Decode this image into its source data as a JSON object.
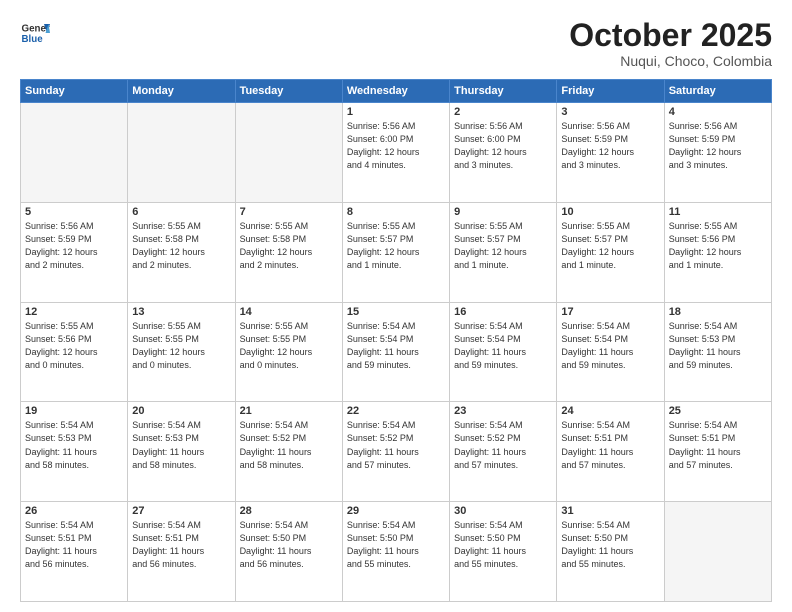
{
  "header": {
    "logo_line1": "General",
    "logo_line2": "Blue",
    "title": "October 2025",
    "subtitle": "Nuqui, Choco, Colombia"
  },
  "weekdays": [
    "Sunday",
    "Monday",
    "Tuesday",
    "Wednesday",
    "Thursday",
    "Friday",
    "Saturday"
  ],
  "weeks": [
    [
      {
        "day": "",
        "info": "",
        "empty": true
      },
      {
        "day": "",
        "info": "",
        "empty": true
      },
      {
        "day": "",
        "info": "",
        "empty": true
      },
      {
        "day": "1",
        "info": "Sunrise: 5:56 AM\nSunset: 6:00 PM\nDaylight: 12 hours\nand 4 minutes.",
        "empty": false
      },
      {
        "day": "2",
        "info": "Sunrise: 5:56 AM\nSunset: 6:00 PM\nDaylight: 12 hours\nand 3 minutes.",
        "empty": false
      },
      {
        "day": "3",
        "info": "Sunrise: 5:56 AM\nSunset: 5:59 PM\nDaylight: 12 hours\nand 3 minutes.",
        "empty": false
      },
      {
        "day": "4",
        "info": "Sunrise: 5:56 AM\nSunset: 5:59 PM\nDaylight: 12 hours\nand 3 minutes.",
        "empty": false
      }
    ],
    [
      {
        "day": "5",
        "info": "Sunrise: 5:56 AM\nSunset: 5:59 PM\nDaylight: 12 hours\nand 2 minutes.",
        "empty": false
      },
      {
        "day": "6",
        "info": "Sunrise: 5:55 AM\nSunset: 5:58 PM\nDaylight: 12 hours\nand 2 minutes.",
        "empty": false
      },
      {
        "day": "7",
        "info": "Sunrise: 5:55 AM\nSunset: 5:58 PM\nDaylight: 12 hours\nand 2 minutes.",
        "empty": false
      },
      {
        "day": "8",
        "info": "Sunrise: 5:55 AM\nSunset: 5:57 PM\nDaylight: 12 hours\nand 1 minute.",
        "empty": false
      },
      {
        "day": "9",
        "info": "Sunrise: 5:55 AM\nSunset: 5:57 PM\nDaylight: 12 hours\nand 1 minute.",
        "empty": false
      },
      {
        "day": "10",
        "info": "Sunrise: 5:55 AM\nSunset: 5:57 PM\nDaylight: 12 hours\nand 1 minute.",
        "empty": false
      },
      {
        "day": "11",
        "info": "Sunrise: 5:55 AM\nSunset: 5:56 PM\nDaylight: 12 hours\nand 1 minute.",
        "empty": false
      }
    ],
    [
      {
        "day": "12",
        "info": "Sunrise: 5:55 AM\nSunset: 5:56 PM\nDaylight: 12 hours\nand 0 minutes.",
        "empty": false
      },
      {
        "day": "13",
        "info": "Sunrise: 5:55 AM\nSunset: 5:55 PM\nDaylight: 12 hours\nand 0 minutes.",
        "empty": false
      },
      {
        "day": "14",
        "info": "Sunrise: 5:55 AM\nSunset: 5:55 PM\nDaylight: 12 hours\nand 0 minutes.",
        "empty": false
      },
      {
        "day": "15",
        "info": "Sunrise: 5:54 AM\nSunset: 5:54 PM\nDaylight: 11 hours\nand 59 minutes.",
        "empty": false
      },
      {
        "day": "16",
        "info": "Sunrise: 5:54 AM\nSunset: 5:54 PM\nDaylight: 11 hours\nand 59 minutes.",
        "empty": false
      },
      {
        "day": "17",
        "info": "Sunrise: 5:54 AM\nSunset: 5:54 PM\nDaylight: 11 hours\nand 59 minutes.",
        "empty": false
      },
      {
        "day": "18",
        "info": "Sunrise: 5:54 AM\nSunset: 5:53 PM\nDaylight: 11 hours\nand 59 minutes.",
        "empty": false
      }
    ],
    [
      {
        "day": "19",
        "info": "Sunrise: 5:54 AM\nSunset: 5:53 PM\nDaylight: 11 hours\nand 58 minutes.",
        "empty": false
      },
      {
        "day": "20",
        "info": "Sunrise: 5:54 AM\nSunset: 5:53 PM\nDaylight: 11 hours\nand 58 minutes.",
        "empty": false
      },
      {
        "day": "21",
        "info": "Sunrise: 5:54 AM\nSunset: 5:52 PM\nDaylight: 11 hours\nand 58 minutes.",
        "empty": false
      },
      {
        "day": "22",
        "info": "Sunrise: 5:54 AM\nSunset: 5:52 PM\nDaylight: 11 hours\nand 57 minutes.",
        "empty": false
      },
      {
        "day": "23",
        "info": "Sunrise: 5:54 AM\nSunset: 5:52 PM\nDaylight: 11 hours\nand 57 minutes.",
        "empty": false
      },
      {
        "day": "24",
        "info": "Sunrise: 5:54 AM\nSunset: 5:51 PM\nDaylight: 11 hours\nand 57 minutes.",
        "empty": false
      },
      {
        "day": "25",
        "info": "Sunrise: 5:54 AM\nSunset: 5:51 PM\nDaylight: 11 hours\nand 57 minutes.",
        "empty": false
      }
    ],
    [
      {
        "day": "26",
        "info": "Sunrise: 5:54 AM\nSunset: 5:51 PM\nDaylight: 11 hours\nand 56 minutes.",
        "empty": false
      },
      {
        "day": "27",
        "info": "Sunrise: 5:54 AM\nSunset: 5:51 PM\nDaylight: 11 hours\nand 56 minutes.",
        "empty": false
      },
      {
        "day": "28",
        "info": "Sunrise: 5:54 AM\nSunset: 5:50 PM\nDaylight: 11 hours\nand 56 minutes.",
        "empty": false
      },
      {
        "day": "29",
        "info": "Sunrise: 5:54 AM\nSunset: 5:50 PM\nDaylight: 11 hours\nand 55 minutes.",
        "empty": false
      },
      {
        "day": "30",
        "info": "Sunrise: 5:54 AM\nSunset: 5:50 PM\nDaylight: 11 hours\nand 55 minutes.",
        "empty": false
      },
      {
        "day": "31",
        "info": "Sunrise: 5:54 AM\nSunset: 5:50 PM\nDaylight: 11 hours\nand 55 minutes.",
        "empty": false
      },
      {
        "day": "",
        "info": "",
        "empty": true
      }
    ]
  ]
}
